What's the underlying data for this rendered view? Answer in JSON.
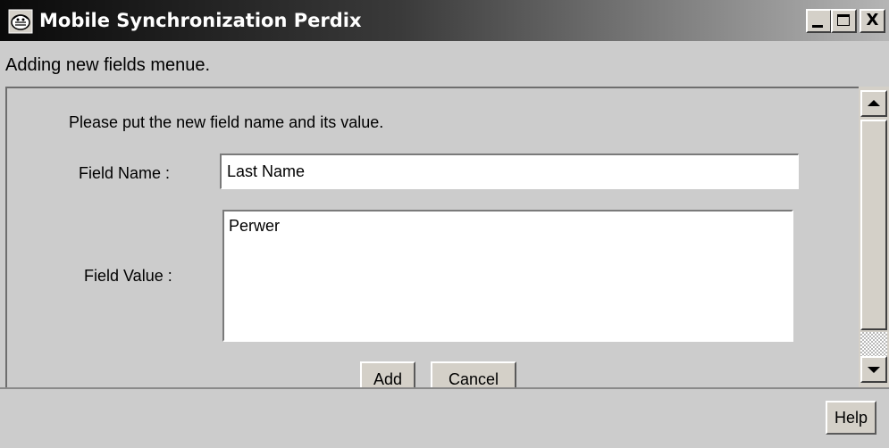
{
  "window": {
    "title": "Mobile Synchronization Perdix",
    "icon": "app-icon",
    "controls": {
      "minimize": "minimize-icon",
      "maximize": "maximize-icon",
      "close_label": "X"
    }
  },
  "header": {
    "label": "Adding new fields menue."
  },
  "form": {
    "instruction": "Please put the new field name and its value.",
    "field_name_label": "Field Name :",
    "field_name_value": "Last Name",
    "field_value_label": "Field Value :",
    "field_value_value": "Perwer",
    "add_label": "Add",
    "cancel_label": "Cancel"
  },
  "footer": {
    "help_label": "Help"
  },
  "colors": {
    "face": "#d4d0c8",
    "background": "#cccccc",
    "title_start": "#0a0a0a",
    "title_end": "#b5b5b5"
  }
}
